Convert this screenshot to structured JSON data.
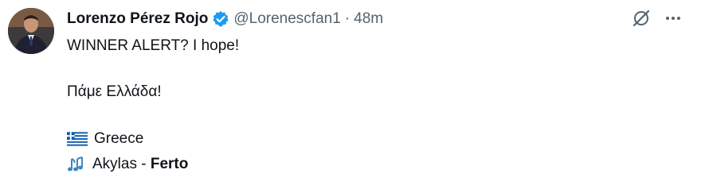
{
  "tweet": {
    "author_name": "Lorenzo Pérez Rojo",
    "handle": "@Lorenescfan1",
    "separator": "·",
    "time": "48m",
    "verified_icon": "verified-badge-icon",
    "lines": {
      "line1": "WINNER ALERT? I hope!",
      "line2": "Πάμε Ελλάδα!",
      "country": "Greece",
      "artist": "Akylas",
      "dash": " - ",
      "song": "Ferto"
    },
    "icons": {
      "grok": "grok-icon",
      "more": "more-options-icon",
      "flag": "greece-flag-icon",
      "notes": "musical-notes-icon"
    },
    "colors": {
      "verified": "#1d9bf0",
      "secondary_text": "#536471",
      "primary_text": "#0f1419",
      "flag_blue": "#0d5eaf",
      "notes_blue": "#3b88c3"
    }
  }
}
